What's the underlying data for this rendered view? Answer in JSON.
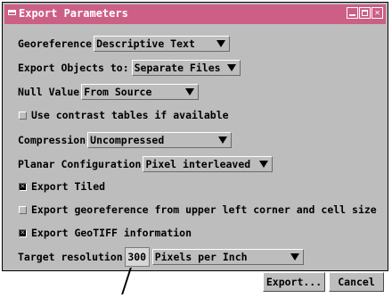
{
  "window": {
    "title": "Export Parameters"
  },
  "georeference": {
    "label": "Georeference",
    "value": "Descriptive Text"
  },
  "export_objects": {
    "label": "Export Objects to:",
    "value": "Separate Files"
  },
  "null_value": {
    "label": "Null Value",
    "value": "From Source"
  },
  "contrast": {
    "label": "Use contrast tables if available",
    "checked": false
  },
  "compression": {
    "label": "Compression",
    "value": "Uncompressed"
  },
  "planar": {
    "label": "Planar Configuration",
    "value": "Pixel interleaved"
  },
  "export_tiled": {
    "label": "Export Tiled",
    "checked": true
  },
  "export_georef": {
    "label": "Export georeference from upper left corner and cell size",
    "checked": false
  },
  "export_geotiff": {
    "label": "Export GeoTIFF information",
    "checked": true
  },
  "resolution": {
    "label": "Target resolution",
    "value": "300",
    "unit": "Pixels per Inch"
  },
  "buttons": {
    "export": "Export...",
    "cancel": "Cancel"
  },
  "colors": {
    "titlebar": "#cc5f86",
    "dialog": "#bdbdbd"
  },
  "icons": [
    "window-menu-icon",
    "minimize-icon",
    "maximize-icon",
    "close-icon",
    "dropdown-arrow-icon",
    "checkbox-icon"
  ]
}
